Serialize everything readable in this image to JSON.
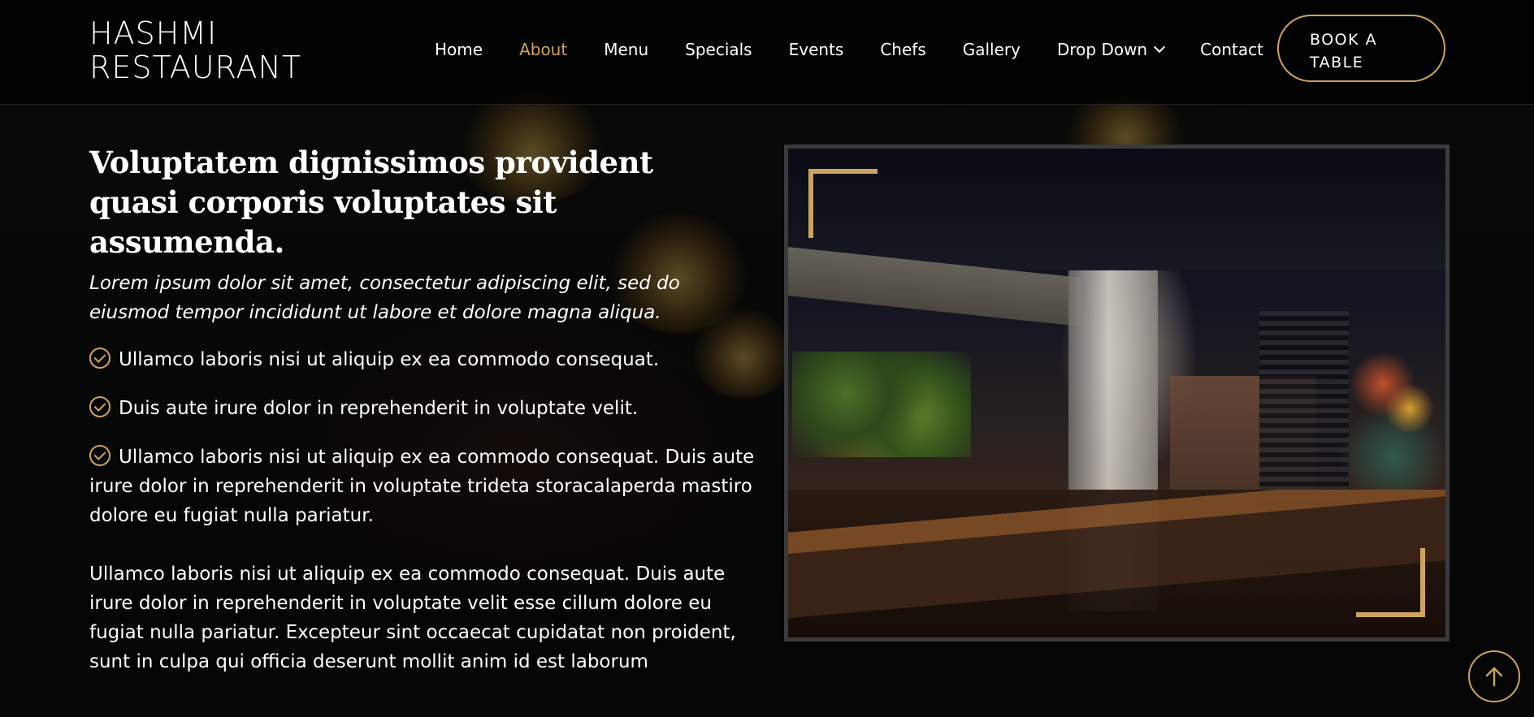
{
  "header": {
    "logo": "HASHMI RESTAURANT",
    "nav": [
      {
        "label": "Home"
      },
      {
        "label": "About"
      },
      {
        "label": "Menu"
      },
      {
        "label": "Specials"
      },
      {
        "label": "Events"
      },
      {
        "label": "Chefs"
      },
      {
        "label": "Gallery"
      },
      {
        "label": "Drop Down"
      },
      {
        "label": "Contact"
      }
    ],
    "active_item": "About",
    "book_button": "BOOK A TABLE"
  },
  "about": {
    "heading": "Voluptatem dignissimos provident quasi corporis voluptates sit assumenda.",
    "subtitle": "Lorem ipsum dolor sit amet, consectetur adipiscing elit, sed do eiusmod tempor incididunt ut labore et dolore magna aliqua.",
    "checklist": [
      "Ullamco laboris nisi ut aliquip ex ea commodo consequat.",
      "Duis aute irure dolor in reprehenderit in voluptate velit.",
      "Ullamco laboris nisi ut aliquip ex ea commodo consequat. Duis aute irure dolor in reprehenderit in voluptate trideta storacalaperda mastiro dolore eu fugiat nulla pariatur."
    ],
    "paragraph": "Ullamco laboris nisi ut aliquip ex ea commodo consequat. Duis aute irure dolor in reprehenderit in voluptate velit esse cillum dolore eu fugiat nulla pariatur. Excepteur sint occaecat cupidatat non proident, sunt in culpa qui officia deserunt mollit anim id est laborum"
  },
  "icons": {
    "check": "check-circle-icon",
    "chevron": "chevron-down-icon",
    "back_to_top": "arrow-up-icon"
  },
  "colors": {
    "accent": "#cda45e",
    "background": "#0c0b09",
    "text": "#ffffff",
    "frame_border": "#3a3b3d"
  }
}
